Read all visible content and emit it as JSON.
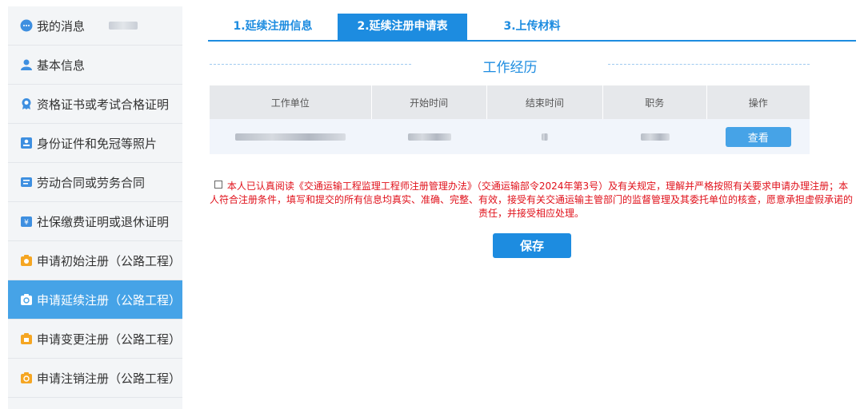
{
  "sidebar": {
    "items": [
      {
        "label": "我的消息",
        "icon": "message-icon",
        "active": false
      },
      {
        "label": "基本信息",
        "icon": "user-icon",
        "active": false
      },
      {
        "label": "资格证书或考试合格证明",
        "icon": "certificate-icon",
        "active": false
      },
      {
        "label": "身份证件和免冠等照片",
        "icon": "id-card-icon",
        "active": false
      },
      {
        "label": "劳动合同或劳务合同",
        "icon": "contract-icon",
        "active": false
      },
      {
        "label": "社保缴费证明或退休证明",
        "icon": "social-security-icon",
        "active": false
      },
      {
        "label": "申请初始注册（公路工程）",
        "icon": "register-icon",
        "active": false
      },
      {
        "label": "申请延续注册（公路工程）",
        "icon": "renew-icon",
        "active": true
      },
      {
        "label": "申请变更注册（公路工程）",
        "icon": "change-icon",
        "active": false
      },
      {
        "label": "申请注销注册（公路工程）",
        "icon": "cancel-icon",
        "active": false
      }
    ]
  },
  "tabs": [
    {
      "label": "1.延续注册信息",
      "active": false
    },
    {
      "label": "2.延续注册申请表",
      "active": true
    },
    {
      "label": "3.上传材料",
      "active": false
    }
  ],
  "section": {
    "title": "工作经历"
  },
  "table": {
    "headers": [
      "工作单位",
      "开始时间",
      "结束时间",
      "职务",
      "操作"
    ],
    "row_action": "查看"
  },
  "agreement": {
    "text": "本人已认真阅读《交通运输工程监理工程师注册管理办法》（交通运输部令2024年第3号）及有关规定，理解并严格按照有关要求申请办理注册；本人符合注册条件，填写和提交的所有信息均真实、准确、完整、有效，接受有关交通运输主管部门的监督管理及其委托单位的核查，愿意承担虚假承诺的责任，并接受相应处理。"
  },
  "buttons": {
    "save": "保存"
  },
  "colors": {
    "primary": "#1d8ce0",
    "sidebar_active": "#46a3e7",
    "warning_text": "#e0101a"
  }
}
